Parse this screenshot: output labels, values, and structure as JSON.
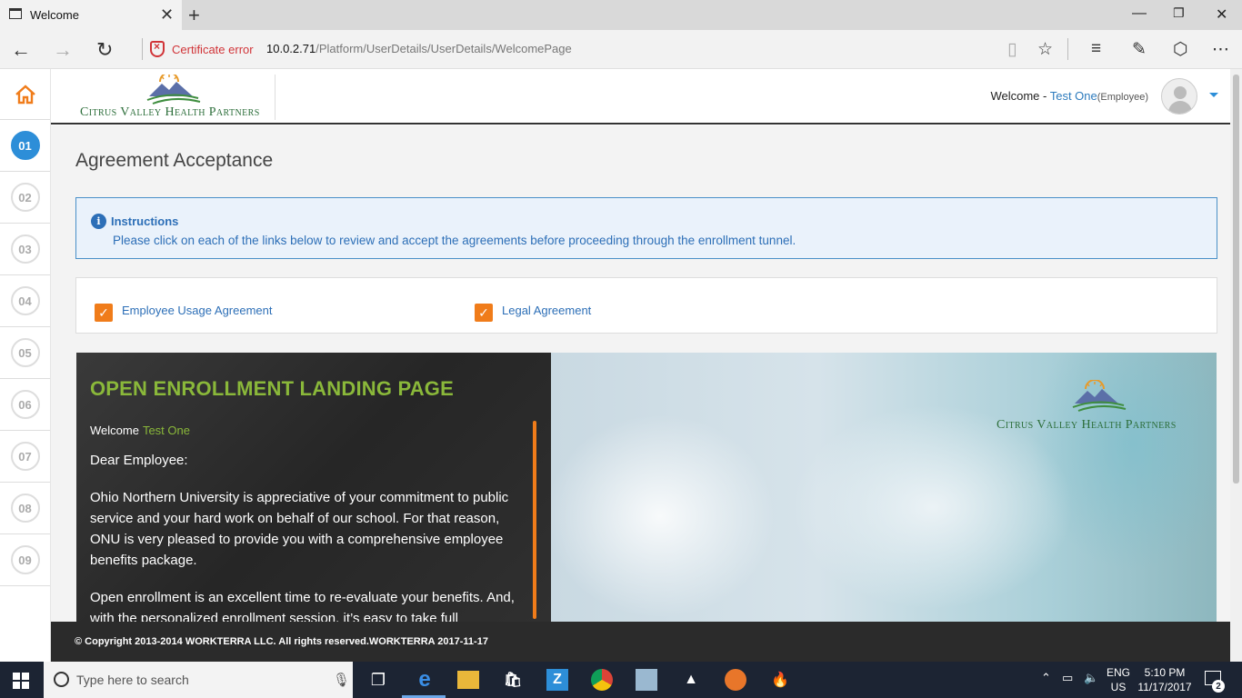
{
  "browser": {
    "tab_title": "Welcome",
    "cert_error": "Certificate error",
    "url_host": "10.0.2.71",
    "url_path": "/Platform/UserDetails/UserDetails/WelcomePage"
  },
  "header": {
    "logo_text": "Citrus Valley Health Partners",
    "welcome_label": "Welcome -",
    "user_name": "Test One",
    "user_role": "(Employee)"
  },
  "steps": [
    "01",
    "02",
    "03",
    "04",
    "05",
    "06",
    "07",
    "08",
    "09"
  ],
  "active_step": "01",
  "main": {
    "page_title": "Agreement Acceptance",
    "instructions": {
      "title": "Instructions",
      "text": "Please click on each of the links below to review and accept the agreements before proceeding through the enrollment tunnel."
    },
    "agreements": [
      {
        "label": "Employee Usage Agreement",
        "checked": true
      },
      {
        "label": "Legal Agreement",
        "checked": true
      }
    ],
    "landing": {
      "title": "OPEN ENROLLMENT LANDING PAGE",
      "welcome_label": "Welcome",
      "welcome_name": "Test One",
      "greeting": "Dear Employee:",
      "paragraph1": "Ohio Northern University is appreciative of your commitment to public service and your hard work on behalf of our school. For that reason, ONU is very pleased to provide you with a comprehensive employee benefits package.",
      "paragraph2": "Open enrollment is an excellent time to re-evaluate your benefits. And, with the personalized enrollment session, it’s easy to take full",
      "logo_text": "Citrus Valley Health Partners"
    }
  },
  "footer": {
    "copyright": "© Copyright 2013-2014 WORKTERRA LLC. All rights reserved.WORKTERRA 2017-11-17"
  },
  "taskbar": {
    "search_placeholder": "Type here to search",
    "lang_top": "ENG",
    "lang_bottom": "US",
    "time": "5:10 PM",
    "date": "11/17/2017",
    "notifications": "2"
  },
  "colors": {
    "accent_blue": "#2d8ed8",
    "accent_orange": "#f07c1a",
    "landing_green": "#8ab83a",
    "cert_red": "#d13438"
  }
}
